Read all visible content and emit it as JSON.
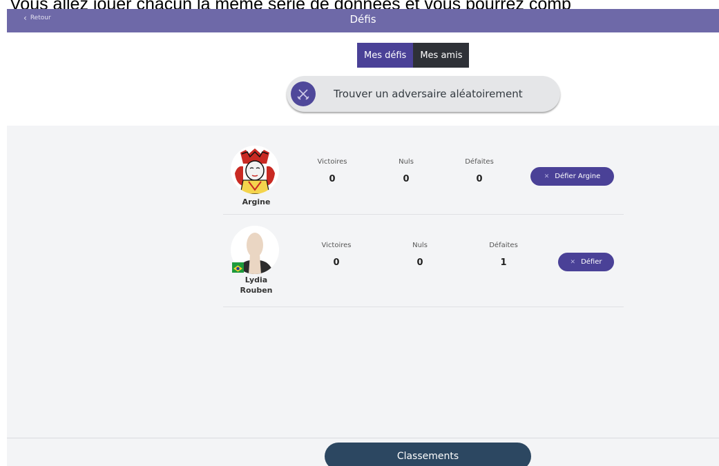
{
  "banner": {
    "text": "Vous allez jouer chacun la même série de données et vous pourrez comp"
  },
  "topbar": {
    "back_label": "Retour",
    "title": "Défis"
  },
  "tabs": [
    {
      "label": "Mes défis",
      "active": true
    },
    {
      "label": "Mes amis",
      "active": false
    }
  ],
  "random_opponent": {
    "label": "Trouver un adversaire aléatoirement",
    "icon": "crossed-swords-icon"
  },
  "players": [
    {
      "name": "Argine",
      "avatar": "queen-card-avatar",
      "stats": [
        {
          "label": "Victoires",
          "value": "0"
        },
        {
          "label": "Nuls",
          "value": "0"
        },
        {
          "label": "Défaites",
          "value": "0"
        }
      ],
      "challenge_label": "Défier Argine"
    },
    {
      "name_line1": "Lydia",
      "name_line2": "Rouben",
      "avatar": "default-user-avatar",
      "flag": "brazil-flag",
      "stats": [
        {
          "label": "Victoires",
          "value": "0"
        },
        {
          "label": "Nuls",
          "value": "0"
        },
        {
          "label": "Défaites",
          "value": "1"
        }
      ],
      "challenge_label": "Défier"
    }
  ],
  "footer": {
    "ranking_label": "Classements"
  },
  "colors": {
    "topbar": "#6e69a8",
    "accent": "#4a4197",
    "dark_tab": "#2e3137",
    "ranking_button": "#2c4761",
    "content_bg": "#f3f4f6"
  }
}
